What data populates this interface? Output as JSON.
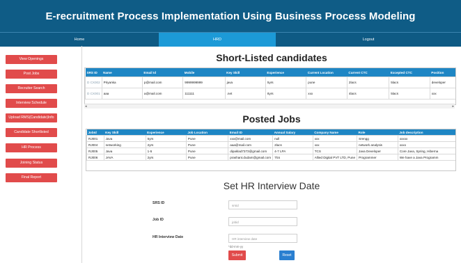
{
  "header": {
    "title": "E-recruitment Process Implementation Using Business Process Modeling"
  },
  "nav": {
    "items": [
      "Home",
      "HRD",
      "Logout"
    ],
    "active": "HRD"
  },
  "sidebar": {
    "items": [
      "View Openings",
      "Post Jobs",
      "Recruiter Search",
      "Interview Schedule",
      "Upload RMS(Candidate)Info",
      "Candidate Shortlisted",
      "HR Process",
      "Joining Status",
      "Final Report"
    ]
  },
  "shortlisted": {
    "title": "Short-Listed candidates",
    "columns": [
      "SRS ID",
      "Name",
      "Email Id",
      "Mobile",
      "Key Skill",
      "Experience",
      "Current Location",
      "Current CTC",
      "Excepted CTC",
      "Position"
    ],
    "rows": [
      [
        "D CX002",
        "Priyanka",
        "p@mail.com",
        "9999999999",
        "java",
        "5yrs",
        "pune",
        "2lacs",
        "5lacs",
        "developer"
      ],
      [
        "D CX001",
        "aaa",
        "a@mail.com",
        "111111",
        ".net",
        "8yrs",
        "xxx",
        "4lacs",
        "5lacs",
        "xxx"
      ]
    ]
  },
  "posted_jobs": {
    "title": "Posted Jobs",
    "columns": [
      "JobId",
      "Key Skill",
      "Experience",
      "Job Location",
      "Email ID",
      "Annual Salary",
      "Company Name",
      "Role",
      "Job description"
    ],
    "rows": [
      [
        "RJ001",
        "Java",
        "5yrs",
        "Pune",
        "xxx@mail.com",
        "null",
        "xxx",
        "Srengg",
        "xxxxx"
      ],
      [
        "RJ004",
        "networking",
        "2yrs",
        "Pune",
        "aaa@mail.com",
        "2lacs",
        "xxx",
        "network analysis",
        "xxxx"
      ],
      [
        "RJ005",
        "Java",
        "1-5",
        "Pune",
        "dipaklad7373@gmail.com",
        "4-7 LPA",
        "TCS",
        "Java Developer",
        "Core Java, Spring, Hiberna"
      ],
      [
        "RJ006",
        "JAVA",
        "2yrs",
        "Pune",
        "prashant.dudam@gmail.com",
        "7lcs",
        "Allied Digital PVT LTD, Pune",
        "Programmer",
        "We have a Java Programm"
      ]
    ]
  },
  "form": {
    "title": "Set HR Interview Date",
    "fields": [
      {
        "label": "SRS ID",
        "placeholder": "srsid"
      },
      {
        "label": "Job ID",
        "placeholder": "jobid"
      },
      {
        "label": "HR Interview Date",
        "placeholder": "HR interview date"
      }
    ],
    "date_hint": "*dd-mm-yy",
    "submit_label": "Submit",
    "reset_label": "Reset"
  },
  "colors": {
    "header": "#0f5c86",
    "nav_active": "#1c9ad7",
    "sidebar_button": "#e14b4b",
    "table_header": "#1e86c4",
    "submit": "#e14b4b",
    "reset": "#2a7fd0"
  }
}
